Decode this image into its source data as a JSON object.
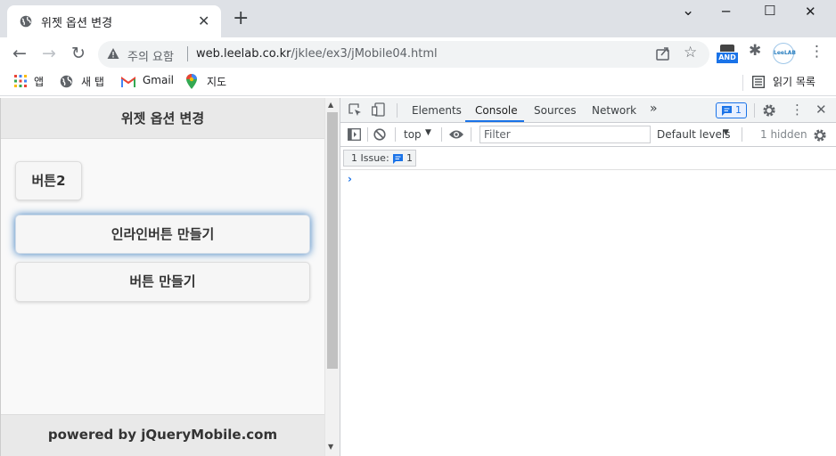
{
  "browser": {
    "tab_title": "위젯 옵션 변경",
    "tab_close": "✕",
    "new_tab": "+",
    "window_controls": {
      "minimize": "─",
      "maximize": "☐",
      "close": "✕",
      "collapse": "⌄"
    },
    "nav": {
      "back": "←",
      "forward": "→",
      "reload": "↻"
    },
    "omnibox": {
      "security_label": "주의 요함",
      "url_host": "web.leelab.co.kr",
      "url_path": "/jklee/ex3/jMobile04.html",
      "star": "☆"
    },
    "extensions": {
      "and_label": "AND",
      "leelab_label": "LeeLAB",
      "menu": "⋮",
      "puzzle": "✱"
    },
    "bookmarks": [
      {
        "label": "앱",
        "icon": "apps-grid-icon"
      },
      {
        "label": "새 탭",
        "icon": "globe-icon"
      },
      {
        "label": "Gmail",
        "icon": "gmail-icon"
      },
      {
        "label": "지도",
        "icon": "maps-pin-icon"
      }
    ],
    "reading_list": "읽기 목록"
  },
  "page": {
    "header": "위젯 옵션 변경",
    "buttons": [
      {
        "label": "버튼2"
      },
      {
        "label": "인라인버튼 만들기",
        "focused": true
      },
      {
        "label": "버튼 만들기"
      }
    ],
    "footer": "powered by jQueryMobile.com"
  },
  "devtools": {
    "tabs": [
      "Elements",
      "Console",
      "Sources",
      "Network"
    ],
    "active_tab": "Console",
    "more": "»",
    "issue_badge_count": "1",
    "context": "top",
    "filter_placeholder": "Filter",
    "levels": "Default levels",
    "hidden": "1 hidden",
    "issues_label": "1 Issue:",
    "issues_count": "1",
    "prompt": "›"
  },
  "colors": {
    "accent": "#1a73e8",
    "focus_glow": "#387bbe",
    "page_bg": "#f9f9f9",
    "bar_bg": "#e9e9e9"
  }
}
